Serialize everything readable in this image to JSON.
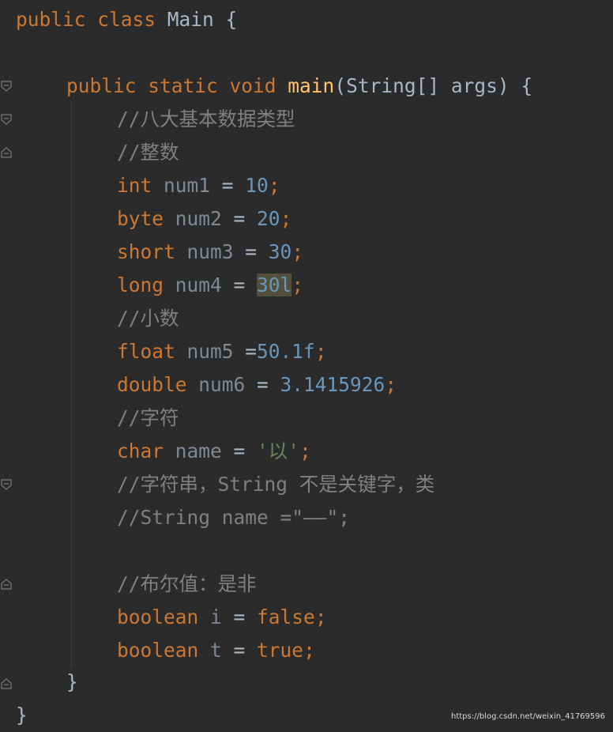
{
  "editor": {
    "lines": [
      {
        "parts": [
          "public ",
          "class ",
          "Main {"
        ]
      },
      {
        "parts": [
          "public ",
          "static ",
          "void ",
          "main",
          "(String[] args) {"
        ]
      },
      {
        "parts": [
          "//八大基本数据类型"
        ]
      },
      {
        "parts": [
          "//整数"
        ]
      },
      {
        "parts": [
          "int ",
          "num1 ",
          "= ",
          "10",
          ";"
        ]
      },
      {
        "parts": [
          "byte ",
          "num2 ",
          "= ",
          "20",
          ";"
        ]
      },
      {
        "parts": [
          "short ",
          "num3 ",
          "= ",
          "30",
          ";"
        ]
      },
      {
        "parts": [
          "long ",
          "num4 ",
          "= ",
          "30l",
          ";"
        ]
      },
      {
        "parts": [
          "//小数"
        ]
      },
      {
        "parts": [
          "float ",
          "num5 ",
          "=",
          "50.1f",
          ";"
        ]
      },
      {
        "parts": [
          "double ",
          "num6 ",
          "= ",
          "3.1415926",
          ";"
        ]
      },
      {
        "parts": [
          "//字符"
        ]
      },
      {
        "parts": [
          "char ",
          "name ",
          "= ",
          "'以'",
          ";"
        ]
      },
      {
        "parts": [
          "//字符串，String 不是关键字，类"
        ]
      },
      {
        "parts": [
          "//String name =\"——\";"
        ]
      },
      {
        "parts": [
          "//布尔值：是非"
        ]
      },
      {
        "parts": [
          "boolean ",
          "i ",
          "= ",
          "false",
          ";"
        ]
      },
      {
        "parts": [
          "boolean ",
          "t ",
          "= ",
          "true",
          ";"
        ]
      },
      {
        "parts": [
          "}"
        ]
      },
      {
        "parts": [
          "}"
        ]
      }
    ]
  },
  "watermark": "https://blog.csdn.net/weixin_41769596",
  "colors": {
    "background": "#2b2b2b",
    "keyword": "#cc7832",
    "variable": "#7f8a96",
    "number": "#6897bb",
    "comment": "#808080",
    "string": "#6a8759",
    "method": "#ffc66d",
    "text": "#a9b7c6",
    "highlight": "#52503a"
  }
}
